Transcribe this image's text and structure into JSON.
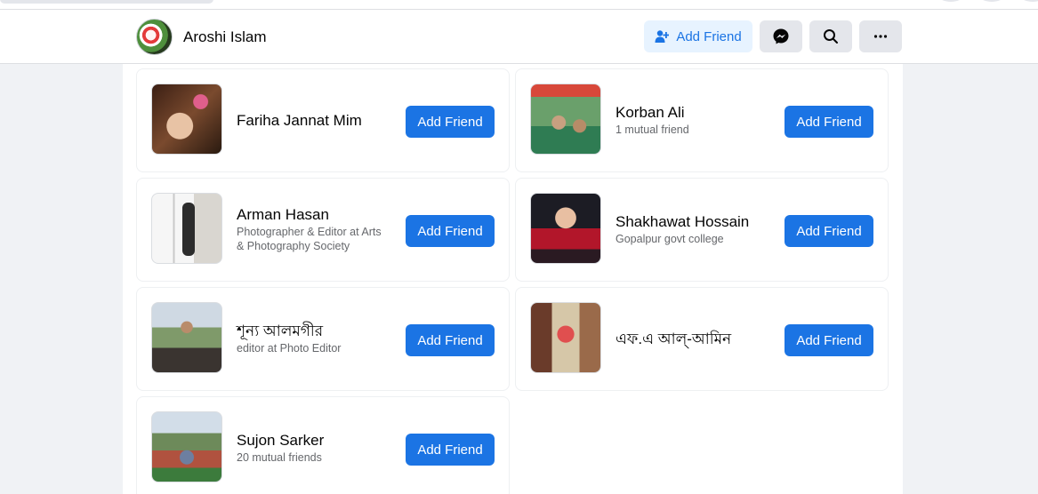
{
  "header": {
    "profile_name": "Aroshi Islam",
    "add_friend_label": "Add Friend",
    "icons": {
      "add_friend": "person-plus-icon",
      "messenger": "messenger-icon",
      "search": "search-icon",
      "more": "more-horizontal-icon"
    },
    "colors": {
      "accent": "#1b74e4",
      "soft_accent_bg": "#e7f3ff"
    }
  },
  "suggestions": [
    {
      "name": "Fariha Jannat Mim",
      "subtitle": "",
      "button": "Add Friend"
    },
    {
      "name": "Korban Ali",
      "subtitle": "1 mutual friend",
      "button": "Add Friend"
    },
    {
      "name": "Arman Hasan",
      "subtitle": "Photographer & Editor at Arts & Photography Society",
      "button": "Add Friend"
    },
    {
      "name": "Shakhawat Hossain",
      "subtitle": "Gopalpur govt college",
      "button": "Add Friend"
    },
    {
      "name": "শূন্য আলমগীর",
      "subtitle": "editor at Photo Editor",
      "button": "Add Friend"
    },
    {
      "name": "এফ.এ আল্-আমিন",
      "subtitle": "",
      "button": "Add Friend"
    },
    {
      "name": "Sujon Sarker",
      "subtitle": "20 mutual friends",
      "button": "Add Friend"
    }
  ]
}
